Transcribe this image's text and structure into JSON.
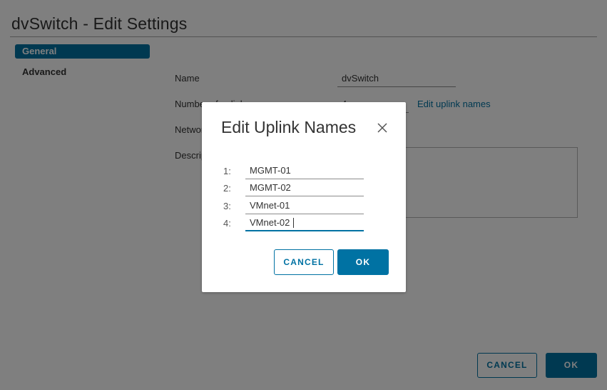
{
  "page": {
    "title": "dvSwitch - Edit Settings"
  },
  "sidebar": {
    "items": [
      {
        "label": "General",
        "selected": true
      },
      {
        "label": "Advanced",
        "selected": false
      }
    ]
  },
  "form": {
    "name_label": "Name",
    "name_value": "dvSwitch",
    "uplinks_label": "Number of uplinks",
    "uplinks_value": "4",
    "edit_uplinks_link": "Edit uplink names",
    "network_label": "Network I/O Control",
    "description_label": "Description",
    "description_value": ""
  },
  "footer": {
    "cancel_label": "CANCEL",
    "ok_label": "OK"
  },
  "dialog": {
    "title": "Edit Uplink Names",
    "close_icon": "close-icon",
    "uplinks": [
      {
        "number": "1:",
        "value": "MGMT-01"
      },
      {
        "number": "2:",
        "value": "MGMT-02"
      },
      {
        "number": "3:",
        "value": "VMnet-01"
      },
      {
        "number": "4:",
        "value": "VMnet-02"
      }
    ],
    "cancel_label": "CANCEL",
    "ok_label": "OK"
  },
  "colors": {
    "accent": "#0072a3",
    "overlay": "rgba(0,0,0,0.5)"
  }
}
